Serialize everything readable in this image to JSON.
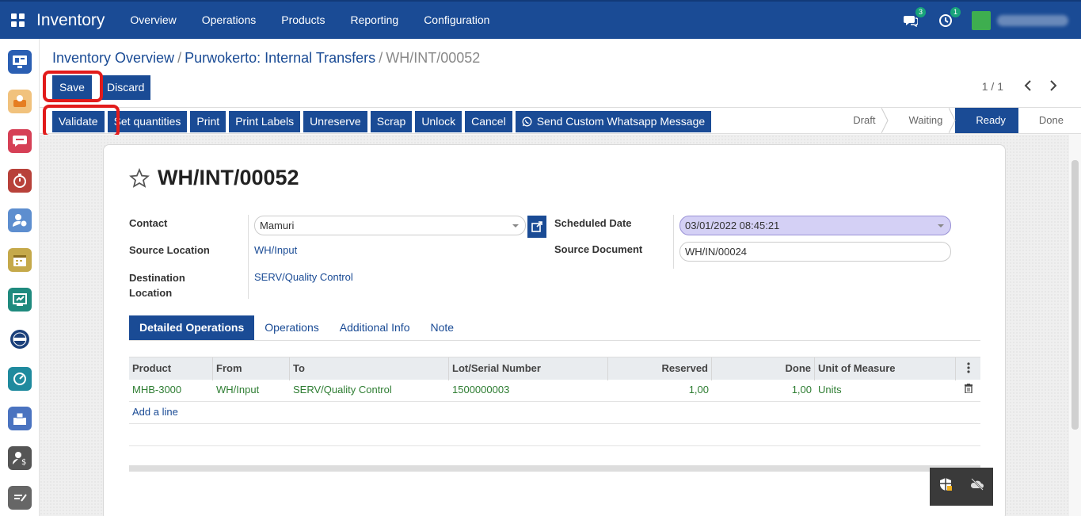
{
  "app": {
    "title": "Inventory",
    "menu": [
      "Overview",
      "Operations",
      "Products",
      "Reporting",
      "Configuration"
    ],
    "messages_count": "3",
    "activities_count": "1"
  },
  "breadcrumb": {
    "root": "Inventory Overview",
    "parent": "Purwokerto: Internal Transfers",
    "current": "WH/INT/00052"
  },
  "buttons": {
    "save": "Save",
    "discard": "Discard",
    "validate": "Validate",
    "set_quantities": "Set quantities",
    "print": "Print",
    "print_labels": "Print Labels",
    "unreserve": "Unreserve",
    "scrap": "Scrap",
    "unlock": "Unlock",
    "cancel": "Cancel",
    "whatsapp": "Send Custom Whatsapp Message"
  },
  "pager": "1 / 1",
  "stages": [
    "Draft",
    "Waiting",
    "Ready",
    "Done"
  ],
  "active_stage": "Ready",
  "record": {
    "title": "WH/INT/00052",
    "contact_label": "Contact",
    "contact_value": "Mamuri",
    "source_location_label": "Source Location",
    "source_location_value": "WH/Input",
    "destination_location_label": "Destination Location",
    "destination_location_value": "SERV/Quality Control",
    "scheduled_date_label": "Scheduled Date",
    "scheduled_date_value": "03/01/2022 08:45:21",
    "source_document_label": "Source Document",
    "source_document_value": "WH/IN/00024"
  },
  "tabs": [
    "Detailed Operations",
    "Operations",
    "Additional Info",
    "Note"
  ],
  "table": {
    "columns": [
      "Product",
      "From",
      "To",
      "Lot/Serial Number",
      "Reserved",
      "Done",
      "Unit of Measure"
    ],
    "rows": [
      {
        "product": "MHB-3000",
        "from": "WH/Input",
        "to": "SERV/Quality Control",
        "lot": "1500000003",
        "reserved": "1,00",
        "done": "1,00",
        "uom": "Units"
      }
    ],
    "add_line": "Add a line"
  },
  "colors": {
    "primary": "#1a4b95",
    "highlight": "#e21b1b",
    "success_text": "#2e7d32",
    "date_field": "#d4d0f5"
  }
}
